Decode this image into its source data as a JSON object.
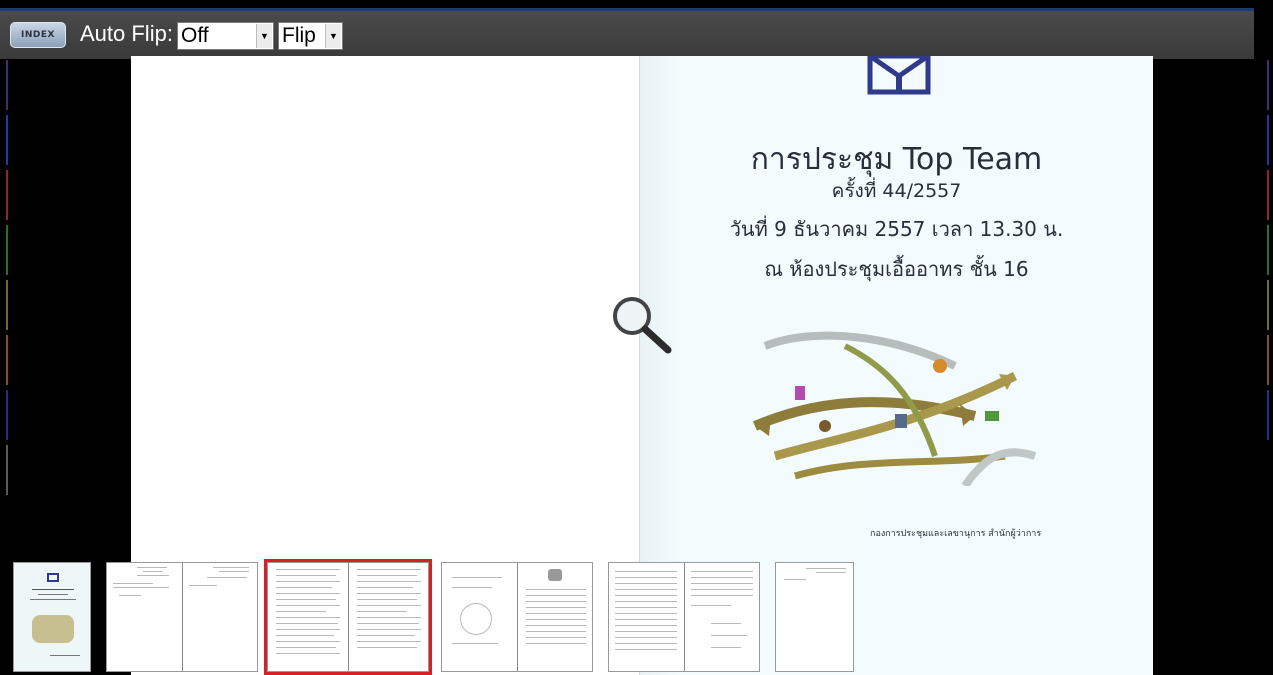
{
  "toolbar": {
    "index_label": "INDEX",
    "autoflip_label": "Auto Flip:",
    "autoflip_value": "Off",
    "flip_value": "Flip",
    "dropdown_arrow": "▼"
  },
  "cover": {
    "title": "การประชุม Top Team",
    "session": "ครั้งที่ 44/2557",
    "date": "วันที่ 9 ธันวาคม 2557 เวลา 13.30 น.",
    "room": "ณ ห้องประชุมเอื้ออาทร ชั้น 16",
    "footer": "กองการประชุมและเลขานุการ สำนักผู้ว่าการ"
  },
  "icons": {
    "zoom": "magnifier-icon",
    "index": "index-book-icon"
  },
  "thumbnails": [
    {
      "label": "cover",
      "selected": false
    },
    {
      "label": "pages-2-3",
      "selected": false
    },
    {
      "label": "pages-4-5",
      "selected": true
    },
    {
      "label": "pages-6-7",
      "selected": false
    },
    {
      "label": "pages-8-9",
      "selected": false
    },
    {
      "label": "page-10",
      "selected": false
    }
  ],
  "colors": {
    "toolbar": "#3f3f3f",
    "selected_thumb": "#d71f26",
    "cover_text": "#2a2d3a"
  }
}
